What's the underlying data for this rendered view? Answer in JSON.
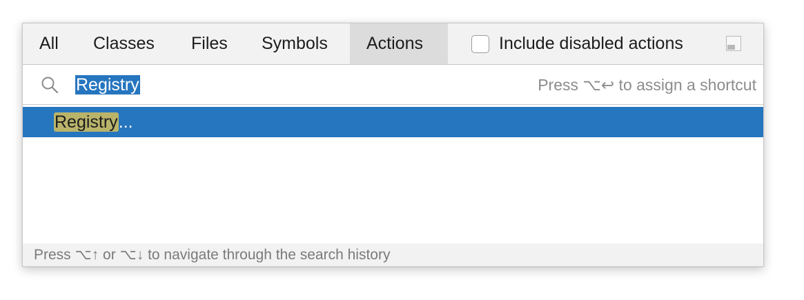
{
  "tabs": [
    {
      "label": "All"
    },
    {
      "label": "Classes"
    },
    {
      "label": "Files"
    },
    {
      "label": "Symbols"
    },
    {
      "label": "Actions"
    }
  ],
  "selected_tab": "Actions",
  "option": {
    "label": "Include disabled actions",
    "checked": false
  },
  "search": {
    "value": "Registry",
    "shortcut_hint": "Press ⌥↩ to assign a shortcut"
  },
  "results": [
    {
      "match": "Registry",
      "rest": "..."
    }
  ],
  "footer": {
    "hint": "Press ⌥↑ or ⌥↓ to navigate through the search history"
  },
  "colors": {
    "selection": "#2675bf",
    "match_highlight": "#b9b46a",
    "tab_selected": "#dcdcdc"
  },
  "icons": [
    "search-icon",
    "pin-icon"
  ]
}
